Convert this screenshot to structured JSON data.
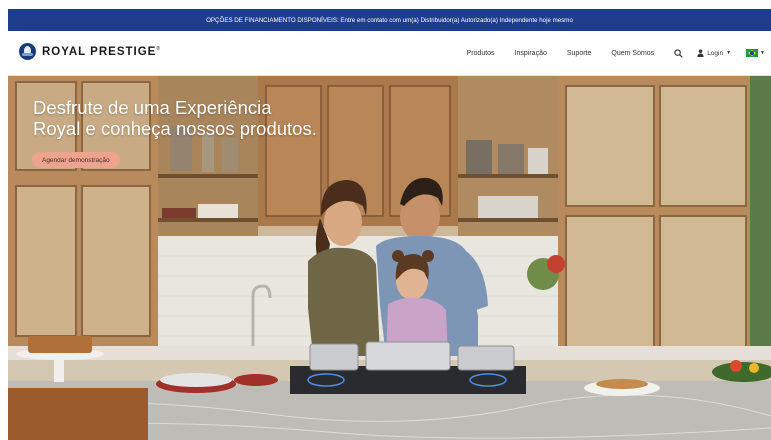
{
  "announcement": {
    "text": "OPÇÕES DE FINANCIAMENTO DISPONÍVEIS: Entre em contato com um(a) Distribuidor(a) Autorizado(a) Independente hoje mesmo"
  },
  "brand": {
    "name": "ROYAL PRESTIGE",
    "mark": "®"
  },
  "nav": {
    "items": [
      {
        "label": "Produtos"
      },
      {
        "label": "Inspiração"
      },
      {
        "label": "Suporte"
      },
      {
        "label": "Quem Somos"
      }
    ],
    "search_icon": "search-icon",
    "login_label": "Login",
    "user_icon": "user-icon",
    "language_icon": "brazil-flag-icon"
  },
  "hero": {
    "title_line1": "Desfrute de uma Experiência",
    "title_line2": "Royal e conheça nossos produtos.",
    "cta_label": "Agendar demonstração"
  },
  "colors": {
    "announcement_bg": "#1f3d8f",
    "cta_bg": "#eda48f",
    "brand_navy": "#1a3b7a"
  }
}
